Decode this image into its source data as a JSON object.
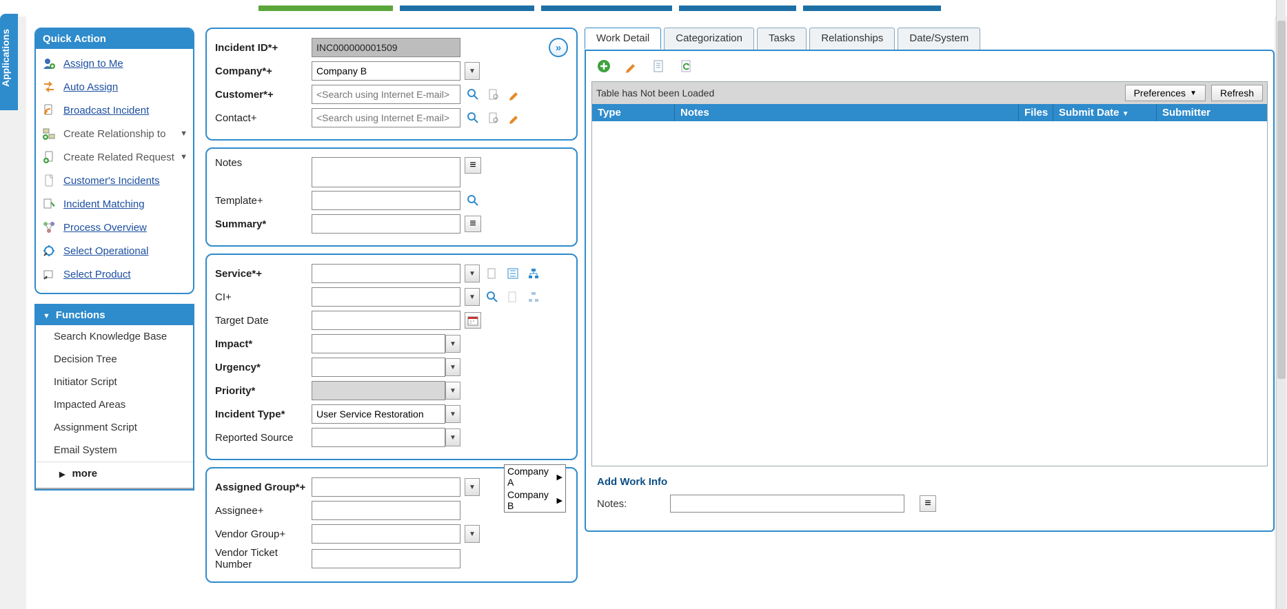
{
  "app_tab": "Applications",
  "quick_action": {
    "title": "Quick Action",
    "items": [
      {
        "label": "Assign to Me",
        "link": true,
        "icon": "user-plus"
      },
      {
        "label": "Auto Assign",
        "link": true,
        "icon": "swap"
      },
      {
        "label": "Broadcast Incident",
        "link": true,
        "icon": "rss"
      },
      {
        "label": "Create Relationship to",
        "link": false,
        "icon": "relation",
        "expand": true
      },
      {
        "label": "Create Related Request",
        "link": false,
        "icon": "new-doc",
        "expand": true
      },
      {
        "label": "Customer's Incidents",
        "link": true,
        "icon": "doc"
      },
      {
        "label": "Incident Matching",
        "link": true,
        "icon": "match"
      },
      {
        "label": "Process Overview",
        "link": true,
        "icon": "process"
      },
      {
        "label": "Select Operational",
        "link": true,
        "icon": "ops"
      },
      {
        "label": "Select Product",
        "link": true,
        "icon": "product"
      }
    ]
  },
  "functions": {
    "title": "Functions",
    "items": [
      "Search Knowledge Base",
      "Decision Tree",
      "Initiator Script",
      "Impacted Areas",
      "Assignment Script",
      "Email System"
    ],
    "more": "more"
  },
  "form": {
    "incident_id": {
      "label": "Incident ID*+",
      "value": "INC000000001509"
    },
    "company": {
      "label": "Company*+",
      "value": "Company B"
    },
    "customer": {
      "label": "Customer*+",
      "placeholder": "<Search using Internet E-mail>"
    },
    "contact": {
      "label": "Contact+",
      "placeholder": "<Search using Internet E-mail>"
    },
    "notes": {
      "label": "Notes"
    },
    "template": {
      "label": "Template+"
    },
    "summary": {
      "label": "Summary*"
    },
    "service": {
      "label": "Service*+"
    },
    "ci": {
      "label": "CI+"
    },
    "target_date": {
      "label": "Target Date"
    },
    "impact": {
      "label": "Impact*"
    },
    "urgency": {
      "label": "Urgency*"
    },
    "priority": {
      "label": "Priority*"
    },
    "incident_type": {
      "label": "Incident Type*",
      "value": "User Service Restoration"
    },
    "reported_source": {
      "label": "Reported Source"
    },
    "assigned_group": {
      "label": "Assigned Group*+"
    },
    "assignee": {
      "label": "Assignee+"
    },
    "vendor_group": {
      "label": "Vendor Group+"
    },
    "vendor_ticket": {
      "label": "Vendor Ticket Number"
    },
    "group_popup": {
      "opt_a": "Company A",
      "opt_b": "Company B"
    }
  },
  "right": {
    "tabs": [
      "Work Detail",
      "Categorization",
      "Tasks",
      "Relationships",
      "Date/System"
    ],
    "grid": {
      "status": "Table has Not been Loaded",
      "preferences": "Preferences",
      "refresh": "Refresh",
      "cols": {
        "type": "Type",
        "notes": "Notes",
        "files": "Files",
        "submit_date": "Submit Date",
        "submitter": "Submitter"
      }
    },
    "add_work_info": {
      "title": "Add Work Info",
      "notes_label": "Notes:"
    }
  }
}
